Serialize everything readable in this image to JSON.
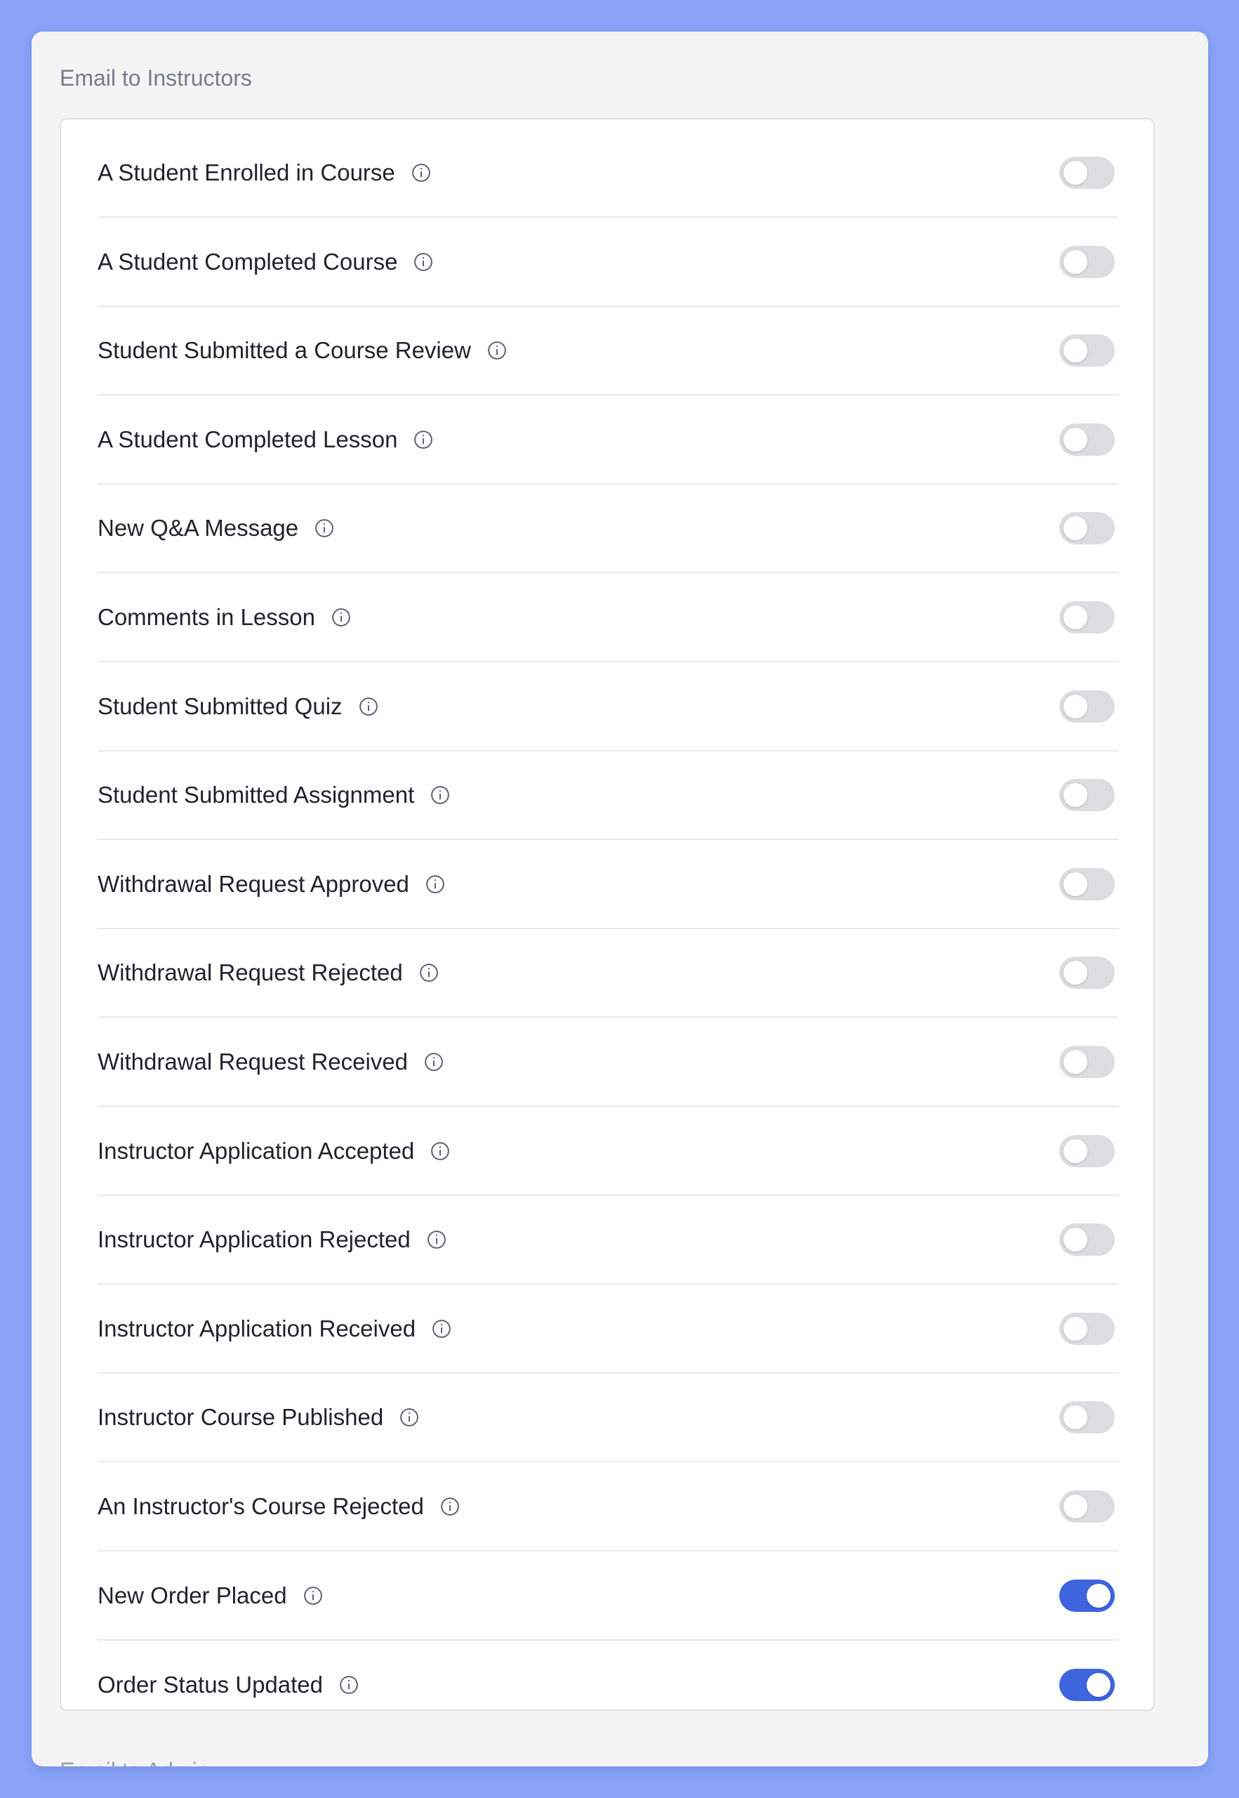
{
  "section": {
    "title": "Email to Instructors",
    "next_title": "Email to Admin"
  },
  "settings": [
    {
      "label": "A Student Enrolled in Course",
      "enabled": false
    },
    {
      "label": "A Student Completed Course",
      "enabled": false
    },
    {
      "label": "Student Submitted a Course Review",
      "enabled": false
    },
    {
      "label": "A Student Completed Lesson",
      "enabled": false
    },
    {
      "label": "New Q&A Message",
      "enabled": false
    },
    {
      "label": "Comments in Lesson",
      "enabled": false
    },
    {
      "label": "Student Submitted Quiz",
      "enabled": false
    },
    {
      "label": "Student Submitted Assignment",
      "enabled": false
    },
    {
      "label": "Withdrawal Request Approved",
      "enabled": false
    },
    {
      "label": "Withdrawal Request Rejected",
      "enabled": false
    },
    {
      "label": "Withdrawal Request Received",
      "enabled": false
    },
    {
      "label": "Instructor Application Accepted",
      "enabled": false
    },
    {
      "label": "Instructor Application Rejected",
      "enabled": false
    },
    {
      "label": "Instructor Application Received",
      "enabled": false
    },
    {
      "label": "Instructor Course Published",
      "enabled": false
    },
    {
      "label": "An Instructor's Course Rejected",
      "enabled": false
    },
    {
      "label": "New Order Placed",
      "enabled": true
    },
    {
      "label": "Order Status Updated",
      "enabled": true
    }
  ],
  "colors": {
    "accent": "#3e64de",
    "toggle_off": "#dcdde1",
    "page_background": "#88a3f7"
  },
  "icons": {
    "row_info": "info-icon"
  }
}
